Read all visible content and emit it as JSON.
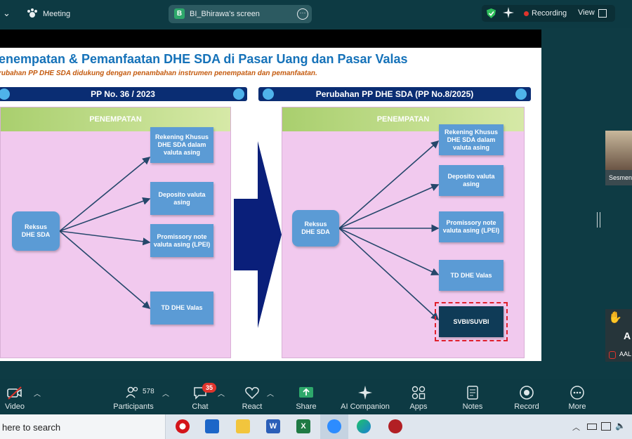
{
  "topbar": {
    "left_chevron": "⌄",
    "meeting_label": "Meeting",
    "share_letter": "B",
    "share_label": "BI_Bhirawa's screen",
    "recording_label": "Recording",
    "view_label": "View"
  },
  "slide": {
    "title": "enempatan & Pemanfaatan DHE SDA di Pasar Uang dan Pasar Valas",
    "subtitle": "rubahan PP DHE SDA didukung dengan penambahan instrumen penempatan dan pemanfaatan.",
    "left": {
      "banner": "PP No. 36 / 2023",
      "header": "PENEMPATAN",
      "source": "Reksus\nDHE SDA",
      "targets": [
        "Rekening Khusus\nDHE SDA dalam\nvaluta asing",
        "Deposito valuta\nasing",
        "Promissory note\nvaluta asing (LPEI)",
        "TD DHE Valas"
      ]
    },
    "right": {
      "banner": "Perubahan PP DHE SDA (PP No.8/2025)",
      "header": "PENEMPATAN",
      "source": "Reksus\nDHE SDA",
      "targets": [
        "Rekening Khusus\nDHE SDA dalam\nvaluta asing",
        "Deposito valuta\nasing",
        "Promissory note\nvaluta asing (LPEI)",
        "TD DHE Valas",
        "SVBI/SUVBI"
      ]
    }
  },
  "participants_panel": {
    "tile1_name": "Sesmen",
    "tile2_initial": "A",
    "tile2_name": "AAL"
  },
  "toolbar": {
    "video": "Video",
    "participants": "Participants",
    "participants_count": "578",
    "chat": "Chat",
    "chat_badge": "35",
    "react": "React",
    "share": "Share",
    "ai": "AI Companion",
    "apps": "Apps",
    "notes": "Notes",
    "record": "Record",
    "more": "More"
  },
  "taskbar": {
    "search_text": "here to search"
  },
  "colors": {
    "background": "#0e3b44",
    "slide_blue": "#1572b9",
    "box_blue": "#5b9bd5",
    "banner_navy": "#0a2d73",
    "panel_pink": "#f1c9ee",
    "recording_red": "#e0342c"
  }
}
